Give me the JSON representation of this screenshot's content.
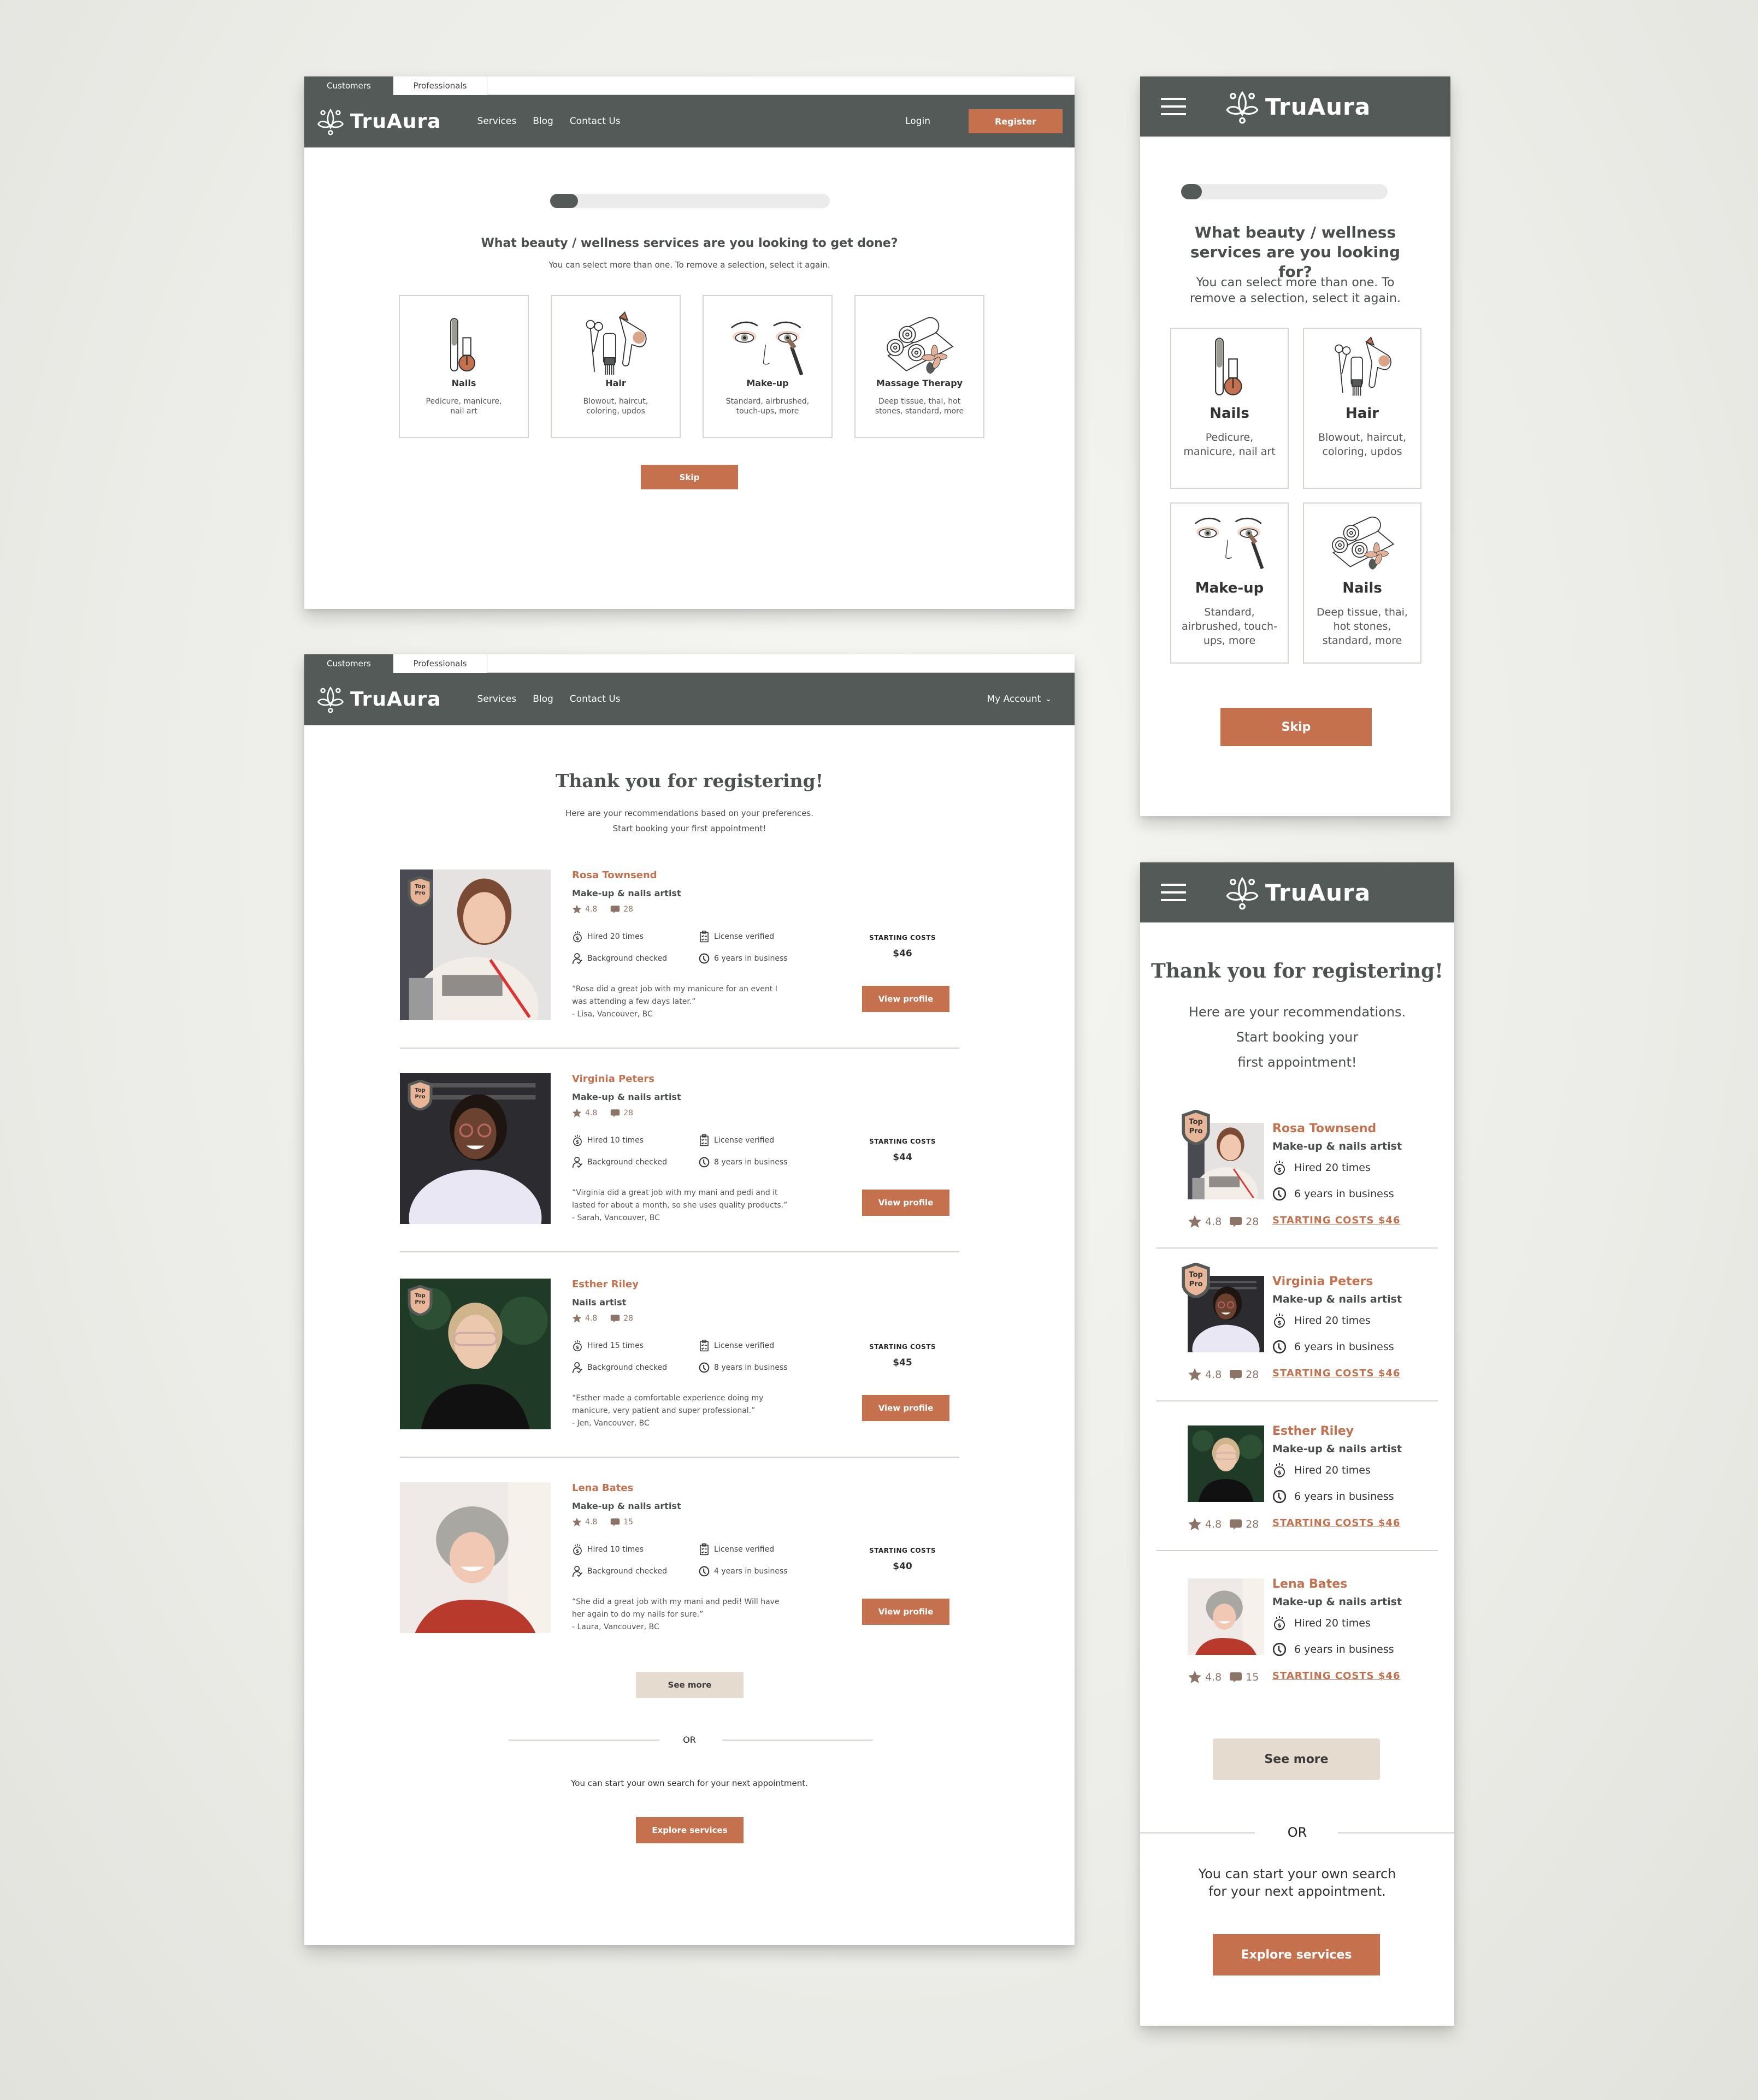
{
  "brand": {
    "name": "TruAura",
    "accent": "#c6714d",
    "header_bg": "#535a57",
    "secondary_btn": "#e5dbcf"
  },
  "desktop_tabs": [
    {
      "label": "Customers",
      "active": true
    },
    {
      "label": "Professionals",
      "active": false
    }
  ],
  "desktop_nav": {
    "links": [
      "Services",
      "Blog",
      "Contact Us"
    ],
    "login": "Login",
    "register": "Register",
    "my_account": "My Account"
  },
  "onboarding": {
    "progress_fraction": 0.1,
    "desktop_title": "What beauty / wellness services are you looking to get done?",
    "mobile_title": "What beauty / wellness services are you looking for?",
    "subtitle": "You can select more than one. To remove a selection, select it again.",
    "services_desktop": [
      {
        "name": "Nails",
        "desc": "Pedicure, manicure, nail art",
        "icon": "nail-polish-icon"
      },
      {
        "name": "Hair",
        "desc": "Blowout, haircut, coloring, updos",
        "icon": "hair-tools-icon"
      },
      {
        "name": "Make-up",
        "desc": "Standard, airbrushed, touch-ups, more",
        "icon": "makeup-eyes-icon"
      },
      {
        "name": "Massage Therapy",
        "desc": "Deep tissue, thai, hot stones, standard, more",
        "icon": "towels-icon"
      }
    ],
    "services_mobile": [
      {
        "name": "Nails",
        "desc": "Pedicure, manicure, nail art"
      },
      {
        "name": "Hair",
        "desc": "Blowout, haircut, coloring, updos"
      },
      {
        "name": "Make-up",
        "desc": "Standard, airbrushed, touch-ups, more"
      },
      {
        "name": "Nails",
        "desc": "Deep tissue, thai, hot stones, standard, more"
      }
    ],
    "skip": "Skip"
  },
  "results": {
    "title": "Thank you for registering!",
    "desktop_sub1": "Here are your recommendations based on your preferences.",
    "desktop_sub2": "Start booking your first appointment!",
    "mobile_sub1": "Here are your recommendations.",
    "mobile_sub2": "Start booking your",
    "mobile_sub3": "first appointment!",
    "badge_top": "Top",
    "badge_pro": "Pro",
    "starting_costs_label": "STARTING COSTS",
    "view_profile": "View profile",
    "license": "License verified",
    "background": "Background checked",
    "pros": [
      {
        "name": "Rosa Townsend",
        "role": "Make-up & nails artist",
        "rating": "4.8",
        "reviews": "28",
        "hired": "Hired 20 times",
        "years": "6 years in business",
        "cost": "$46",
        "top_pro": true,
        "quote1": "“Rosa did a great job with my manicure for an event I",
        "quote2": "was attending a few days later.”",
        "author": "- Lisa, Vancouver, BC"
      },
      {
        "name": "Virginia Peters",
        "role": "Make-up & nails artist",
        "rating": "4.8",
        "reviews": "28",
        "hired": "Hired 10 times",
        "years": "8 years in business",
        "cost": "$44",
        "top_pro": true,
        "quote1": "“Virginia did a great job with my mani and pedi and it",
        "quote2": "lasted for about a month, so she uses quality products.”",
        "author": "- Sarah, Vancouver, BC"
      },
      {
        "name": "Esther Riley",
        "role": "Nails artist",
        "rating": "4.8",
        "reviews": "28",
        "hired": "Hired 15 times",
        "years": "8 years in business",
        "cost": "$45",
        "top_pro": true,
        "quote1": "“Esther made a comfortable experience doing my",
        "quote2": "manicure, very patient and super professional.”",
        "author": "- Jen, Vancouver, BC"
      },
      {
        "name": "Lena Bates",
        "role": "Make-up & nails artist",
        "rating": "4.8",
        "reviews": "15",
        "hired": "Hired 10 times",
        "years": "4 years in business",
        "cost": "$40",
        "top_pro": false,
        "quote1": "“She did a great job with my mani and pedi! Will have",
        "quote2": "her again to do my nails for sure.”",
        "author": "- Laura, Vancouver, BC"
      }
    ],
    "mobile_pros": [
      {
        "name": "Rosa Townsend",
        "role": "Make-up & nails artist",
        "hired": "Hired 20 times",
        "years": "6 years in business",
        "rating": "4.8",
        "reviews": "28",
        "cost_link": "STARTING COSTS $46",
        "top_pro": true
      },
      {
        "name": "Virginia Peters",
        "role": "Make-up & nails artist",
        "hired": "Hired 20 times",
        "years": "6 years in business",
        "rating": "4.8",
        "reviews": "28",
        "cost_link": "STARTING COSTS $46",
        "top_pro": true
      },
      {
        "name": "Esther Riley",
        "role": "Make-up & nails artist",
        "hired": "Hired 20 times",
        "years": "6 years in business",
        "rating": "4.8",
        "reviews": "28",
        "cost_link": "STARTING COSTS $46",
        "top_pro": false
      },
      {
        "name": "Lena Bates",
        "role": "Make-up & nails artist",
        "hired": "Hired 20 times",
        "years": "6 years in business",
        "rating": "4.8",
        "reviews": "15",
        "cost_link": "STARTING COSTS $46",
        "top_pro": false
      }
    ],
    "see_more": "See more",
    "or": "OR",
    "own_search_desktop": "You can start your own search for your next appointment.",
    "own_search_mobile1": "You can start your own search",
    "own_search_mobile2": "for your next appointment.",
    "explore": "Explore services"
  }
}
